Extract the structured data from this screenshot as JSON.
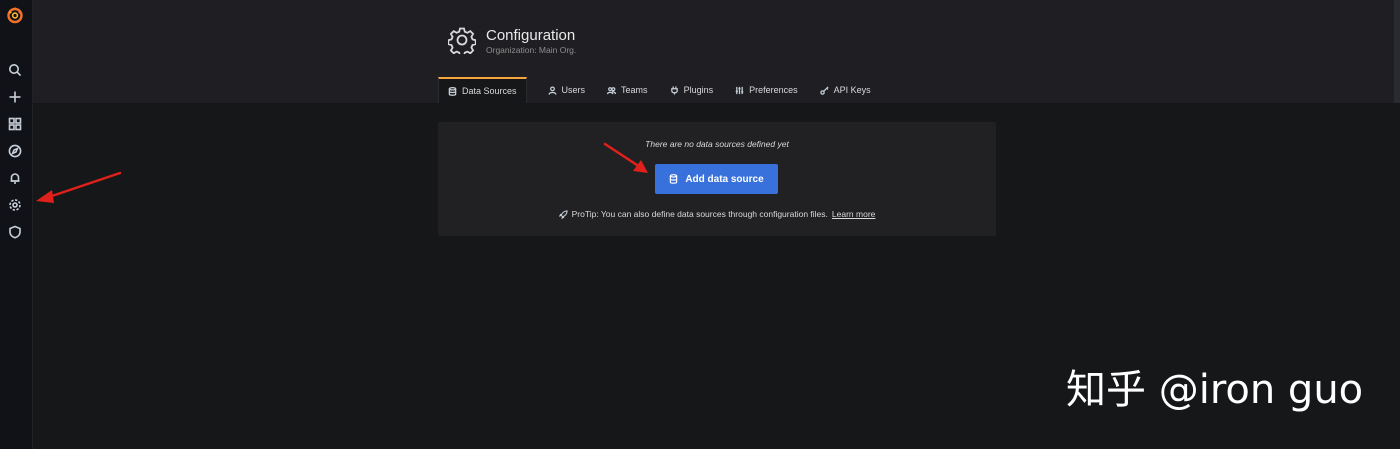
{
  "colors": {
    "accent_tab": "#f5a53b",
    "primary_button": "#3871dc",
    "arrow": "#e0211b"
  },
  "sidebar": {
    "items": [
      {
        "icon": "search-icon"
      },
      {
        "icon": "plus-icon"
      },
      {
        "icon": "dashboards-icon"
      },
      {
        "icon": "explore-compass-icon"
      },
      {
        "icon": "bell-icon"
      },
      {
        "icon": "gear-icon"
      },
      {
        "icon": "shield-icon"
      }
    ]
  },
  "header": {
    "title": "Configuration",
    "subtitle": "Organization: Main Org."
  },
  "tabs": [
    {
      "label": "Data Sources",
      "icon": "database-icon",
      "active": true
    },
    {
      "label": "Users",
      "icon": "user-icon",
      "active": false
    },
    {
      "label": "Teams",
      "icon": "users-icon",
      "active": false
    },
    {
      "label": "Plugins",
      "icon": "plug-icon",
      "active": false
    },
    {
      "label": "Preferences",
      "icon": "sliders-icon",
      "active": false
    },
    {
      "label": "API Keys",
      "icon": "key-icon",
      "active": false
    }
  ],
  "empty_state": {
    "message": "There are no data sources defined yet",
    "button_label": "Add data source",
    "protip_text": "ProTip: You can also define data sources through configuration files.",
    "learn_more": "Learn more"
  },
  "watermark": "知乎 @iron guo"
}
